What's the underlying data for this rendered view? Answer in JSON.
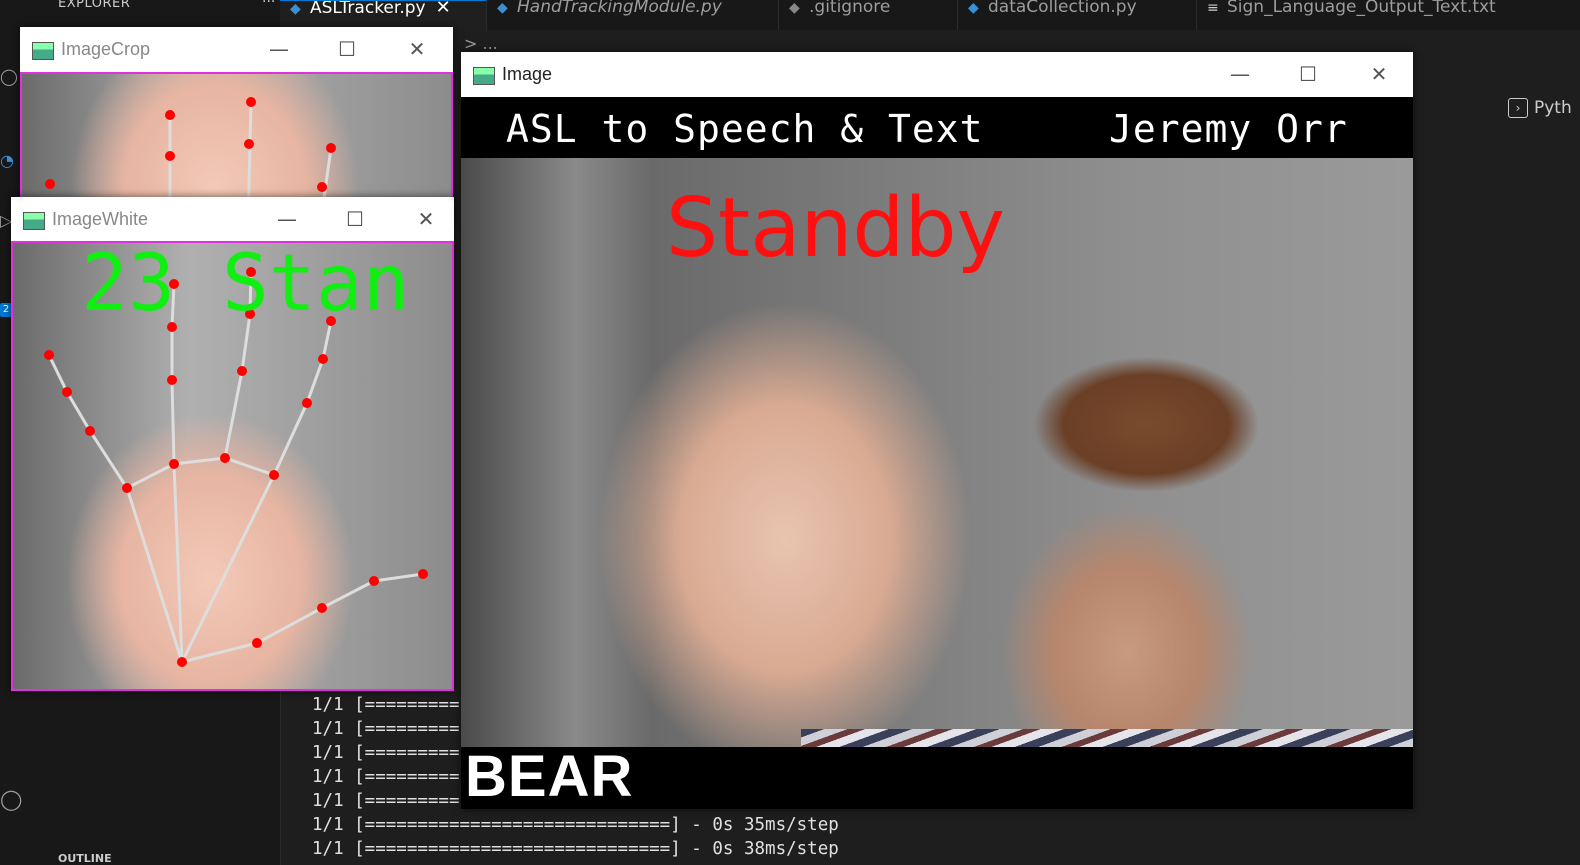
{
  "explorer": {
    "title": "EXPLORER",
    "more": "···",
    "outline_label": "OUTLINE"
  },
  "activity_badge": "2",
  "tabs": [
    {
      "label": "ASLTracker.py",
      "active": true,
      "close": "✕"
    },
    {
      "label": "HandTrackingModule.py",
      "active": false
    },
    {
      "label": ".gitignore",
      "active": false
    },
    {
      "label": "dataCollection.py",
      "active": false
    },
    {
      "label": "Sign_Language_Output_Text.txt",
      "active": false
    }
  ],
  "breadcrumb": "> ...",
  "panel_label": "Pyth",
  "terminal_lines": [
    "1/1 [=========",
    "1/1 [=========",
    "1/1 [=========",
    "1/1 [=========",
    "1/1 [=========",
    "1/1 [=============================] - 0s 35ms/step",
    "1/1 [=============================] - 0s 38ms/step"
  ],
  "windows": {
    "crop": {
      "title": "ImageCrop"
    },
    "white": {
      "title": "ImageWhite",
      "overlay_text": "23 Stan"
    },
    "image": {
      "title": "Image",
      "header_left": "ASL to Speech & Text",
      "header_right": "Jeremy Orr",
      "status": "Standby",
      "output_word": "BEAR"
    }
  },
  "window_controls": {
    "minimize": "—",
    "maximize": "☐",
    "close": "✕"
  },
  "colors": {
    "status": "#ff1010",
    "overlay": "#11ee11",
    "landmark": "#ff0000",
    "crop_border": "#e030e0"
  }
}
